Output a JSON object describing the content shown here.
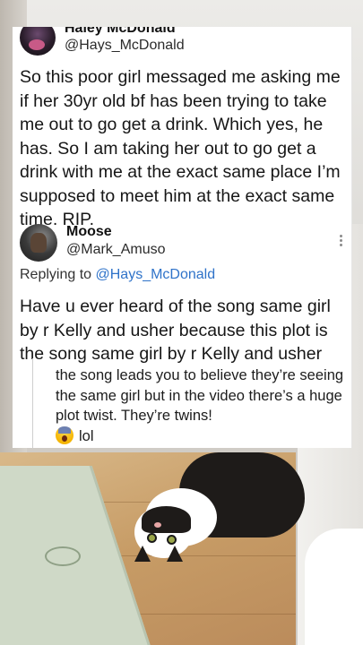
{
  "tweet": {
    "author_name": "Haley McDonald",
    "author_handle": "@Hays_McDonald",
    "text": "So this poor girl messaged me asking me if her 30yr old bf has been trying to take me out to go get a drink. Which yes, he has. So I am taking her out to go get a drink with me at the exact same place I’m supposed to meet him at the exact same time. RIP."
  },
  "reply": {
    "author_name": "Moose",
    "author_handle": "@Mark_Amuso",
    "replying_to_label": "Replying to ",
    "replying_to_handle": "@Hays_McDonald",
    "text": "Have u ever heard of the song same girl by r Kelly and usher because this plot is the song same girl by r Kelly and usher",
    "quote_text": "the song leads you to believe they’re seeing the same girl but in the video there’s a huge plot twist. They’re twins!",
    "quote_emoji": "face-screaming-in-fear",
    "quote_suffix": "lol"
  },
  "icons": {
    "more": "more-vertical-icon"
  },
  "colors": {
    "card_background": "#ffffff",
    "link": "#2f73c9",
    "text": "#161616"
  }
}
